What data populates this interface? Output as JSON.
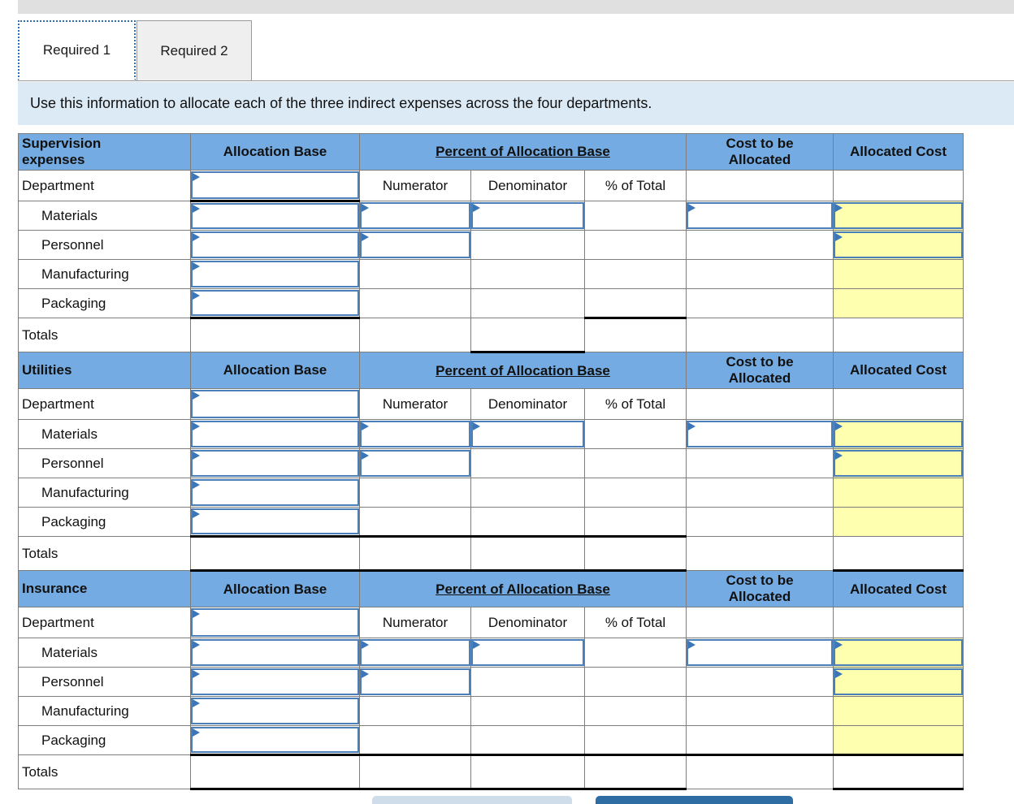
{
  "window": {
    "title": ""
  },
  "tabs": [
    {
      "id": "required-1",
      "label": "Required 1",
      "active": true
    },
    {
      "id": "required-2",
      "label": "Required 2",
      "active": false
    }
  ],
  "banner": {
    "text": "Use this information to allocate each of the three indirect expenses across the four departments."
  },
  "worksheet": {
    "columns": [
      {
        "key": "department",
        "label": ""
      },
      {
        "key": "allocation_base",
        "label": "Allocation Base"
      },
      {
        "key": "numerator",
        "label": "Numerator"
      },
      {
        "key": "denominator",
        "label": "Denominator"
      },
      {
        "key": "percent_of_total",
        "label": "% of Total"
      },
      {
        "key": "cost_to_be_allocated",
        "label": "Cost to be\nAllocated"
      },
      {
        "key": "allocated_cost",
        "label": "Allocated Cost"
      }
    ],
    "group_header": {
      "allocation_base": "Allocation Base",
      "percent_of_allocation_base": "Percent of Allocation Base",
      "cost_to_be_allocated": "Cost to be Allocated",
      "cost_to_be_allocated_line1": "Cost to be",
      "cost_to_be_allocated_line2": "Allocated",
      "allocated_cost": "Allocated Cost"
    },
    "sub_header": {
      "department": "Department",
      "numerator": "Numerator",
      "denominator": "Denominator",
      "percent_of_total": "% of Total"
    },
    "row_labels": {
      "materials": "Materials",
      "personnel": "Personnel",
      "manufacturing": "Manufacturing",
      "packaging": "Packaging",
      "totals": "Totals"
    },
    "sections": [
      {
        "id": "supervision",
        "title_line1": "Supervision",
        "title_line2": "expenses",
        "title": "Supervision expenses"
      },
      {
        "id": "utilities",
        "title_line1": "Utilities",
        "title_line2": "",
        "title": "Utilities"
      },
      {
        "id": "insurance",
        "title_line1": "Insurance",
        "title_line2": "",
        "title": "Insurance"
      }
    ],
    "cell_values": {
      "empty": ""
    }
  },
  "footer": {
    "prev_label": "",
    "next_label": ""
  },
  "colors": {
    "header_blue": "#74abe2",
    "banner_blue": "#dceaf6",
    "input_border_blue": "#4a7fba",
    "answer_yellow": "#ffffb0",
    "grid_grey": "#7d7d7d",
    "next_button_blue": "#2e6da4",
    "prev_button_blue": "#cfdcea",
    "topbar_grey": "#e0e0e0"
  }
}
